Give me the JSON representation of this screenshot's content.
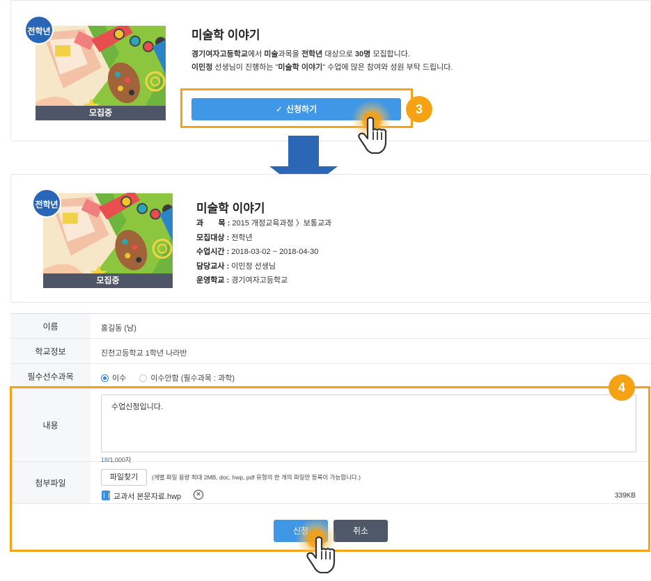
{
  "top_card": {
    "badge": "전학년",
    "status": "모집중",
    "title": "미술학 이야기",
    "desc": {
      "school": "경기여자고등학교",
      "t1": "에서 ",
      "subject": "미술",
      "t2": "과목을 ",
      "grade": "전학년",
      "t3": " 대상으로 ",
      "count": "30명",
      "t4": " 모집합니다.",
      "teacher": "이민정",
      "t5": " 선생님이 진행하는 \"",
      "course": "미술학 이야기",
      "t6": "\" 수업에 많은 참여와 성원 부탁 드립니다."
    },
    "apply_label": "신청하기",
    "step_number": "3"
  },
  "detail_card": {
    "badge": "전학년",
    "status": "모집중",
    "title": "미술학 이야기",
    "meta": [
      {
        "label": "과       목 :",
        "value": "2015 개정교육과정 〉보통교과"
      },
      {
        "label": "모집대상 :",
        "value": "전학년"
      },
      {
        "label": "수업시간 :",
        "value": "2018-03-02 ~ 2018-04-30"
      },
      {
        "label": "담당교사 :",
        "value": "이민정 선생님"
      },
      {
        "label": "운영학교 :",
        "value": "경기여자고등학교"
      }
    ]
  },
  "form": {
    "name_label": "이름",
    "name_value": "홍길동 (남)",
    "school_label": "학교정보",
    "school_value": "진천고등학교 1학년 나라반",
    "required_label": "필수선수과목",
    "option_done": "이수",
    "option_notdone": "이수안함 (필수과목 : 과학)",
    "content_label": "내용",
    "content_value": "수업신청입니다.",
    "counter_current": "18",
    "counter_max": "/1,000자",
    "attach_label": "첨부파일",
    "file_button": "파일찾기",
    "file_note": "(개별 파일 용량 최대 2MB, doc, hwp, pdf 유형의 한 개의 파일만 등록이 가능합니다.)",
    "file_name": "교과서 본문자료.hwp",
    "file_size": "339KB",
    "submit_label": "신청",
    "cancel_label": "취소",
    "step_number": "4"
  },
  "colors": {
    "primary": "#3f97e6",
    "highlight": "#f5a315",
    "arrow": "#2c67b5",
    "badge": "#2a66b8",
    "dark_button": "#4f5869"
  }
}
